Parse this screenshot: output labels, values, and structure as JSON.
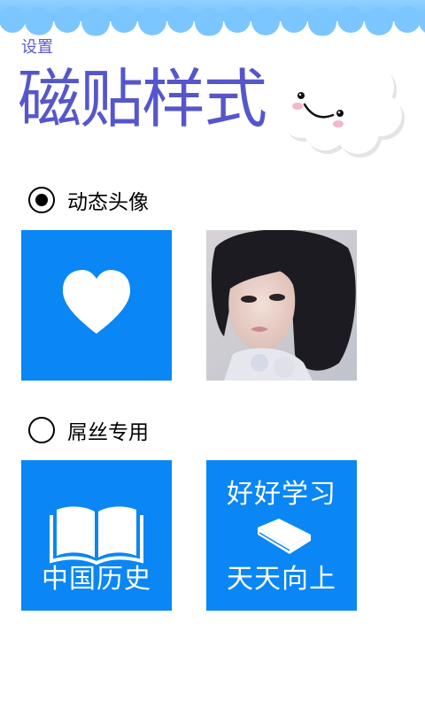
{
  "header": {
    "breadcrumb": "设置",
    "title": "磁贴样式"
  },
  "options": [
    {
      "label": "动态头像",
      "selected": true
    },
    {
      "label": "屌丝专用",
      "selected": false
    }
  ],
  "tiles": {
    "heart": {
      "icon": "heart-icon"
    },
    "photo": {
      "icon": "profile-photo"
    },
    "history": {
      "icon": "open-book-icon",
      "caption": "中国历史"
    },
    "study": {
      "icon": "closed-book-icon",
      "line1": "好好学习",
      "line2": "天天向上"
    }
  },
  "colors": {
    "tile": "#0a86f5",
    "title": "#5656cc",
    "banner": "#7cc6ff"
  }
}
